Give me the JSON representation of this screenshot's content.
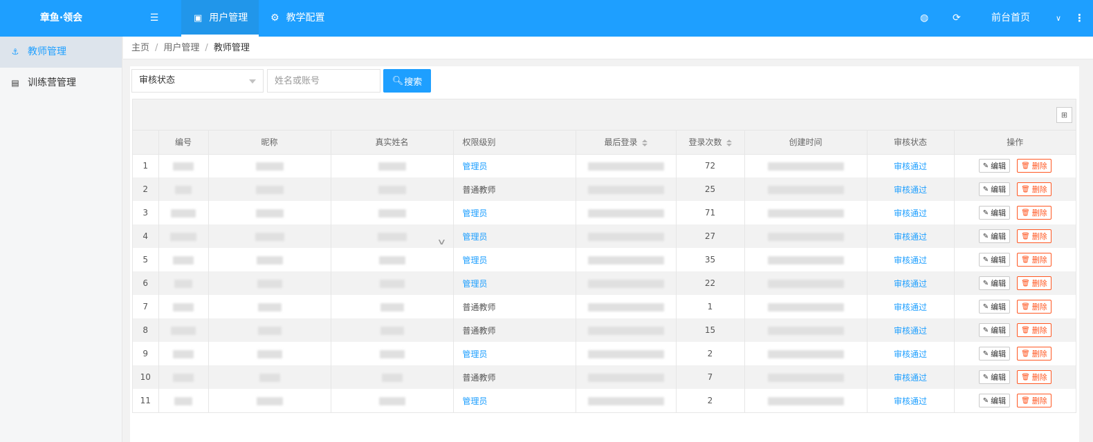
{
  "brand": "章鱼·领会",
  "topnav": {
    "users": "用户管理",
    "teaching": "教学配置",
    "home": "前台首页"
  },
  "sidebar": {
    "items": [
      {
        "label": "教师管理",
        "active": true
      },
      {
        "label": "训练营管理",
        "active": false
      }
    ]
  },
  "breadcrumb": [
    "主页",
    "用户管理",
    "教师管理"
  ],
  "filter": {
    "status_select": "审核状态",
    "search_placeholder": "姓名或账号",
    "search_button": "搜索"
  },
  "table": {
    "headers": [
      "编号",
      "昵称",
      "真实姓名",
      "权限级别",
      "最后登录",
      "登录次数",
      "创建时间",
      "审核状态",
      "操作"
    ],
    "rows": [
      {
        "index": "1",
        "perm": "管理员",
        "perm_type": "admin",
        "login_count": "72",
        "status": "审核通过"
      },
      {
        "index": "2",
        "perm": "普通教师",
        "perm_type": "teacher",
        "login_count": "25",
        "status": "审核通过"
      },
      {
        "index": "3",
        "perm": "管理员",
        "perm_type": "admin",
        "login_count": "71",
        "status": "审核通过"
      },
      {
        "index": "4",
        "perm": "管理员",
        "perm_type": "admin",
        "login_count": "27",
        "status": "审核通过"
      },
      {
        "index": "5",
        "perm": "管理员",
        "perm_type": "admin",
        "login_count": "35",
        "status": "审核通过"
      },
      {
        "index": "6",
        "perm": "管理员",
        "perm_type": "admin",
        "login_count": "22",
        "status": "审核通过"
      },
      {
        "index": "7",
        "perm": "普通教师",
        "perm_type": "teacher",
        "login_count": "1",
        "status": "审核通过"
      },
      {
        "index": "8",
        "perm": "普通教师",
        "perm_type": "teacher",
        "login_count": "15",
        "status": "审核通过"
      },
      {
        "index": "9",
        "perm": "管理员",
        "perm_type": "admin",
        "login_count": "2",
        "status": "审核通过"
      },
      {
        "index": "10",
        "perm": "普通教师",
        "perm_type": "teacher",
        "login_count": "7",
        "status": "审核通过"
      },
      {
        "index": "11",
        "perm": "管理员",
        "perm_type": "admin",
        "login_count": "2",
        "status": "审核通过"
      }
    ],
    "edit_label": "编辑",
    "delete_label": "删除"
  },
  "colors": {
    "primary": "#1e9fff",
    "danger": "#ff5722"
  }
}
